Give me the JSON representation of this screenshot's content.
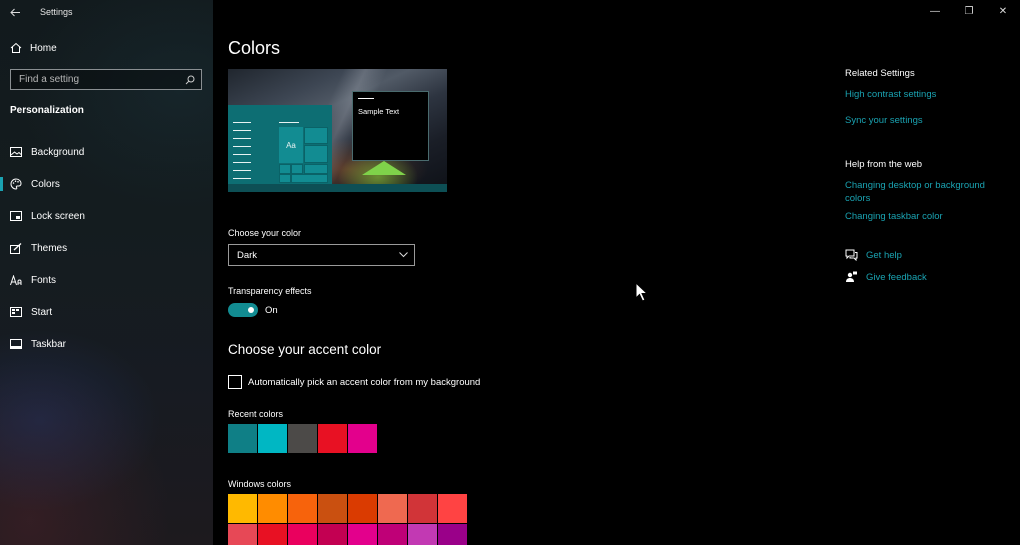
{
  "window": {
    "title": "Settings",
    "controls": {
      "minimize": "—",
      "maximize": "❐",
      "close": "✕"
    }
  },
  "sidebar": {
    "home_label": "Home",
    "search_placeholder": "Find a setting",
    "section_label": "Personalization",
    "items": [
      {
        "label": "Background",
        "icon": "picture-icon",
        "active": false
      },
      {
        "label": "Colors",
        "icon": "palette-icon",
        "active": true
      },
      {
        "label": "Lock screen",
        "icon": "lock-screen-icon",
        "active": false
      },
      {
        "label": "Themes",
        "icon": "themes-icon",
        "active": false
      },
      {
        "label": "Fonts",
        "icon": "fonts-icon",
        "active": false
      },
      {
        "label": "Start",
        "icon": "start-icon",
        "active": false
      },
      {
        "label": "Taskbar",
        "icon": "taskbar-icon",
        "active": false
      }
    ]
  },
  "main": {
    "title": "Colors",
    "preview": {
      "sample_text": "Sample Text",
      "tile_text": "Aa"
    },
    "choose_color": {
      "label": "Choose your color",
      "value": "Dark"
    },
    "transparency": {
      "label": "Transparency effects",
      "state": "On"
    },
    "accent_heading": "Choose your accent color",
    "auto_pick_label": "Automatically pick an accent color from my background",
    "recent_colors": {
      "label": "Recent colors",
      "colors": [
        "#0f7f86",
        "#00b7c3",
        "#4c4a48",
        "#e81123",
        "#e3008c"
      ]
    },
    "windows_colors": {
      "label": "Windows colors",
      "row1": [
        "#ffb900",
        "#ff8c00",
        "#f7630c",
        "#ca5010",
        "#da3b01",
        "#ef6950",
        "#d13438",
        "#ff4343"
      ],
      "row2": [
        "#e74856",
        "#e81123",
        "#ea005e",
        "#c30052",
        "#e3008c",
        "#bf0077",
        "#c239b3",
        "#9a0089"
      ]
    }
  },
  "right_panel": {
    "related_heading": "Related Settings",
    "related_links": [
      "High contrast settings",
      "Sync your settings"
    ],
    "help_heading": "Help from the web",
    "help_links": [
      "Changing desktop or background colors",
      "Changing taskbar color"
    ],
    "get_help": "Get help",
    "give_feedback": "Give feedback"
  },
  "colors": {
    "accent": "#1aa3b2",
    "toggle_on": "#128c92"
  }
}
